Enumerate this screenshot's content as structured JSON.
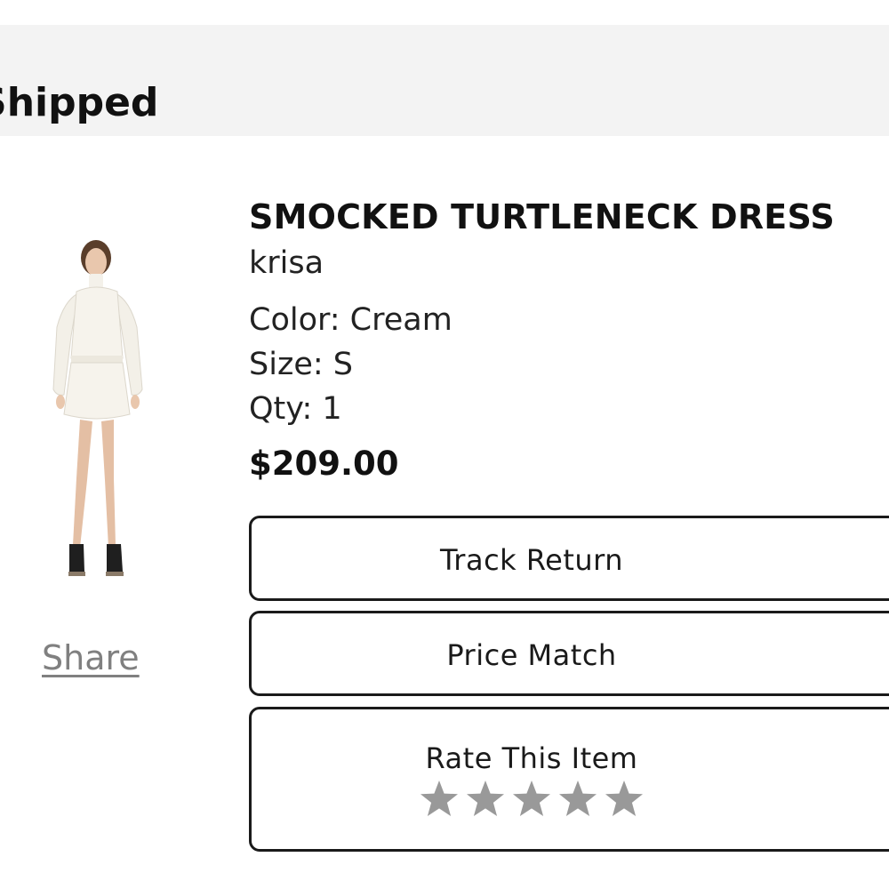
{
  "header": {
    "status": "Shipped"
  },
  "product": {
    "title": "SMOCKED TURTLENECK DRESS",
    "brand": "krisa",
    "color_line": "Color: Cream",
    "size_line": "Size: S",
    "qty_line": "Qty: 1",
    "price": "$209.00",
    "image_icon": "dress-product-photo"
  },
  "share": {
    "label": "Share"
  },
  "actions": {
    "track_return_label": "Track Return",
    "price_match_label": "Price Match",
    "rate_label": "Rate This Item"
  },
  "rating": {
    "max": 5,
    "value": 0,
    "star_icon": "star-icon",
    "star_color": "#999999"
  },
  "colors": {
    "status_band": "#f3f3f3",
    "share_link": "#808080",
    "button_border": "#1a1a1a"
  }
}
